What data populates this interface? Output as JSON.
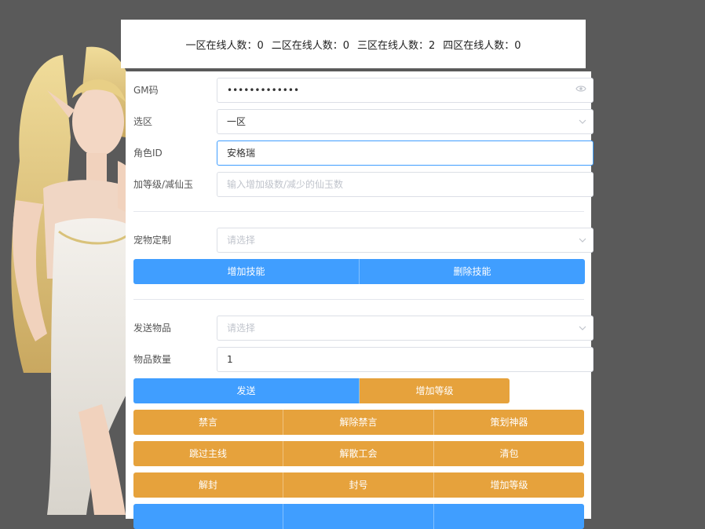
{
  "header": {
    "zones": [
      "一区在线人数：0",
      "二区在线人数：0",
      "三区在线人数：2",
      "四区在线人数：0"
    ]
  },
  "form": {
    "gm": {
      "label": "GM码",
      "value": "•••••••••••••"
    },
    "zone": {
      "label": "选区",
      "value": "一区"
    },
    "role": {
      "label": "角色ID",
      "value": "安格瑞"
    },
    "level": {
      "label": "加等级/减仙玉",
      "placeholder": "输入增加级数/减少的仙玉数"
    },
    "pet": {
      "label": "宠物定制",
      "placeholder": "请选择"
    },
    "item": {
      "label": "发送物品",
      "placeholder": "请选择"
    },
    "qty": {
      "label": "物品数量",
      "value": "1"
    }
  },
  "buttons": {
    "add_skill": "增加技能",
    "del_skill": "删除技能",
    "send": "发送",
    "add_level": "增加等级",
    "mute": "禁言",
    "unmute": "解除禁言",
    "planner_weapon": "策划神器",
    "skip_main": "跳过主线",
    "dissolve_guild": "解散工会",
    "clear_bag": "清包",
    "unban": "解封",
    "ban": "封号",
    "add_level2": "增加等级"
  },
  "colors": {
    "primary": "#409eff",
    "warning": "#e6a23c",
    "background": "#5a5a5a"
  },
  "icons": {
    "eye": "eye-icon",
    "chevron": "chevron-down-icon"
  }
}
